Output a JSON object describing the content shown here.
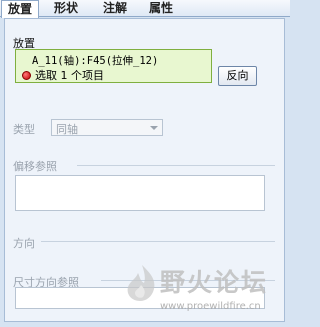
{
  "tabs": [
    {
      "label": "放置",
      "active": true
    },
    {
      "label": "形状",
      "active": false
    },
    {
      "label": "注解",
      "active": false
    },
    {
      "label": "属性",
      "active": false
    }
  ],
  "placement": {
    "label": "放置",
    "reference_line": "A_11(轴):F45(拉伸_12)",
    "selection_status": "选取 1 个项目",
    "reverse_button": "反向"
  },
  "type": {
    "label": "类型",
    "value": "同轴"
  },
  "offset_refs": {
    "label": "偏移参照"
  },
  "direction": {
    "label": "方向"
  },
  "dim_direction_refs": {
    "label": "尺寸方向参照"
  },
  "watermark": {
    "title": "野火论坛",
    "url": "www.proewildfire.cn"
  },
  "colors": {
    "selection_bg": "#e8f7d0",
    "selection_border": "#7faf3f",
    "status_dot": "#c40000",
    "disabled_text": "#9aa3ae"
  }
}
